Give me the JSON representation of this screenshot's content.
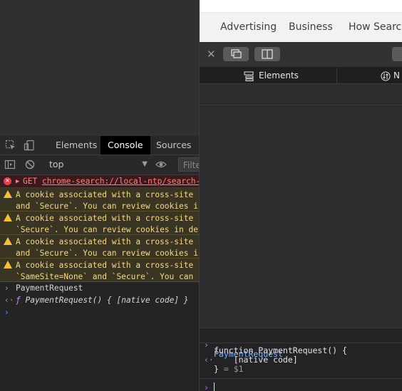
{
  "chrome_devtools": {
    "tabs": [
      "Elements",
      "Console",
      "Sources"
    ],
    "active_tab": "Console",
    "context": "top",
    "filter_placeholder": "Filte",
    "messages": [
      {
        "type": "error",
        "prefix": "GET ",
        "url": "chrome-search://local-ntp/search-"
      },
      {
        "type": "warn",
        "line1": "A cookie associated with a cross-site r",
        "line2": "and `Secure`. You can review cookies in"
      },
      {
        "type": "warn",
        "line1": "A cookie associated with a cross-site r",
        "line2": "`Secure`. You can review cookies in dev"
      },
      {
        "type": "warn",
        "line1": "A cookie associated with a cross-site r",
        "line2": "and `Secure`. You can review cookies in"
      },
      {
        "type": "warn",
        "line1": "A cookie associated with a cross-site r",
        "line2": "`SameSite=None` and `Secure`. You can r"
      }
    ],
    "input_echo": "PaymentRequest",
    "result": "PaymentRequest() { [native code] }",
    "result_fn_marker": "ƒ"
  },
  "browser_page": {
    "links": [
      "Advertising",
      "Business",
      "How Search"
    ]
  },
  "web_inspector": {
    "tabs": [
      "Elements",
      "N"
    ],
    "console_input": "PaymentRequest",
    "console_output_line1": "function PaymentRequest() {",
    "console_output_line2": "    [native code]",
    "console_output_line3_brace": "}",
    "console_output_line3_rest": " = $1"
  }
}
